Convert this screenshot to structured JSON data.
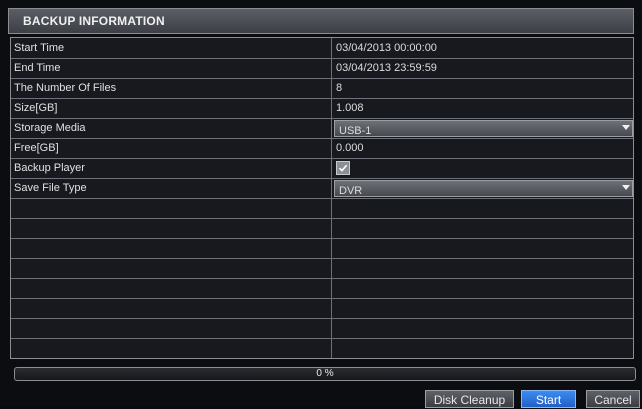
{
  "title": "BACKUP INFORMATION",
  "rows": [
    {
      "label": "Start Time",
      "value": "03/04/2013 00:00:00"
    },
    {
      "label": "End Time",
      "value": "03/04/2013 23:59:59"
    },
    {
      "label": "The Number Of Files",
      "value": "8"
    },
    {
      "label": "Size[GB]",
      "value": "1.008"
    },
    {
      "label": "Storage Media",
      "value": "USB-1"
    },
    {
      "label": "Free[GB]",
      "value": "0.000"
    },
    {
      "label": "Backup Player",
      "value": ""
    },
    {
      "label": "Save File Type",
      "value": "DVR"
    }
  ],
  "backup_player_checked": true,
  "progress": {
    "label": "0 %",
    "percent": 0
  },
  "buttons": {
    "disk_cleanup": "Disk Cleanup",
    "start": "Start",
    "cancel": "Cancel"
  },
  "colors": {
    "accent": "#1f5fc8",
    "panel": "#17191f"
  }
}
